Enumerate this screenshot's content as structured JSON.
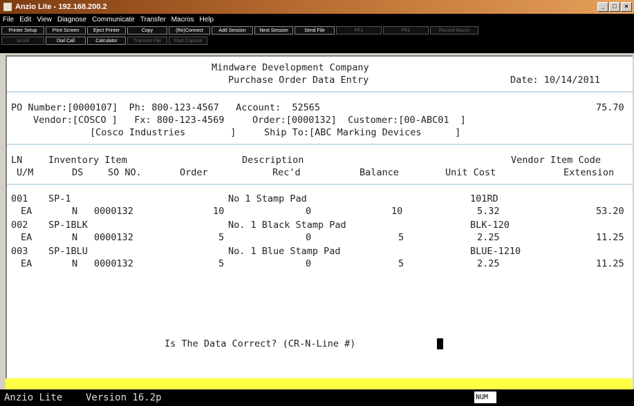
{
  "window": {
    "title": "Anzio Lite - 192.168.200.2",
    "buttons": [
      "_",
      "□",
      "×"
    ]
  },
  "menu": [
    "File",
    "Edit",
    "View",
    "Diagnose",
    "Communicate",
    "Transfer",
    "Macros",
    "Help"
  ],
  "toolbar_row1": [
    {
      "label": "Printer Setup",
      "enabled": true
    },
    {
      "label": "Print Screen",
      "enabled": true
    },
    {
      "label": "Eject Printer",
      "enabled": true
    },
    {
      "label": "Copy",
      "enabled": true
    },
    {
      "label": "(Re)Connect",
      "enabled": true
    },
    {
      "label": "Add Session",
      "enabled": true
    },
    {
      "label": "Next Session",
      "enabled": true
    },
    {
      "label": "Send File",
      "enabled": true
    },
    {
      "label": "PF1",
      "enabled": false
    },
    {
      "label": "PF2",
      "enabled": false
    },
    {
      "label": "Record Macro",
      "enabled": false
    }
  ],
  "toolbar_row2": [
    {
      "label": "Scroll",
      "enabled": false
    },
    {
      "label": "Dial Call",
      "enabled": true
    },
    {
      "label": "Calculator",
      "enabled": true
    },
    {
      "label": "Transmit File",
      "enabled": false
    },
    {
      "label": "Start Capture",
      "enabled": false
    }
  ],
  "screen": {
    "company": "Mindware Development Company",
    "subtitle": "Purchase Order Data Entry",
    "date": "Date: 10/14/2011",
    "po_line": "PO Number:[0000107]  Ph: 800-123-4567   Account:  52565",
    "po_amount": "75.70",
    "vendor_line": "Vendor:[COSCO ]   Fx: 800-123-4569     Order:[0000132]  Customer:[00-ABC01  ]",
    "name_line": "[Cosco Industries        ]     Ship To:[ABC Marking Devices      ]",
    "headers": {
      "ln": "LN",
      "inventory_item": "Inventory Item",
      "description": "Description",
      "vendor_item_code": "Vendor Item Code",
      "um": "U/M",
      "ds": "DS",
      "so_no": "SO NO.",
      "order": "Order",
      "recd": "Rec'd",
      "balance": "Balance",
      "unit_cost": "Unit Cost",
      "extension": "Extension"
    },
    "lines": [
      {
        "ln": "001",
        "item": "SP-1",
        "description": "No 1 Stamp Pad",
        "vendor_code": "101RD",
        "um": "EA",
        "ds": "N",
        "so_no": "0000132",
        "order": "10",
        "recd": "0",
        "balance": "10",
        "unit_cost": "5.32",
        "extension": "53.20"
      },
      {
        "ln": "002",
        "item": "SP-1BLK",
        "description": "No. 1 Black Stamp Pad",
        "vendor_code": "BLK-120",
        "um": "EA",
        "ds": "N",
        "so_no": "0000132",
        "order": "5",
        "recd": "0",
        "balance": "5",
        "unit_cost": "2.25",
        "extension": "11.25"
      },
      {
        "ln": "003",
        "item": "SP-1BLU",
        "description": "No. 1 Blue Stamp Pad",
        "vendor_code": "BLUE-1210",
        "um": "EA",
        "ds": "N",
        "so_no": "0000132",
        "order": "5",
        "recd": "0",
        "balance": "5",
        "unit_cost": "2.25",
        "extension": "11.25"
      }
    ],
    "prompt": "Is The Data Correct? (CR-N-Line #)"
  },
  "status": {
    "version": "Anzio Lite    Version 16.2p",
    "num": "NUM"
  }
}
